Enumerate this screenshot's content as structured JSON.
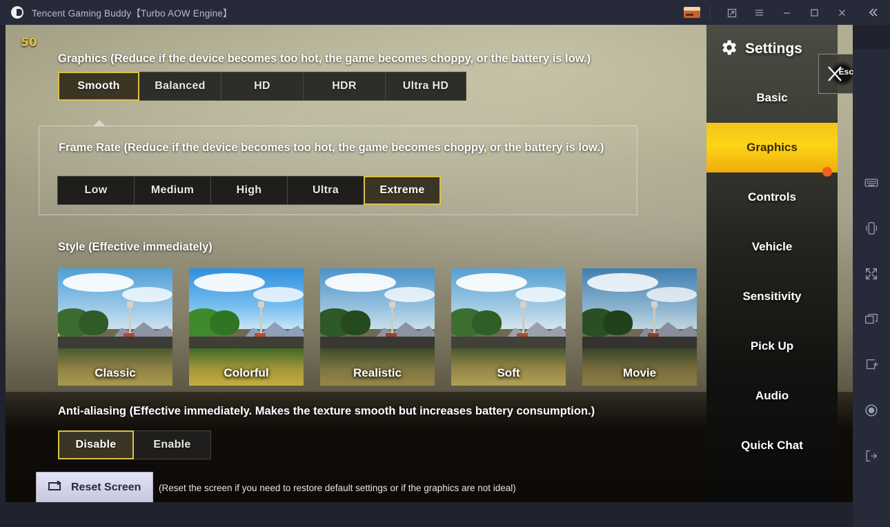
{
  "titlebar": {
    "title": "Tencent Gaming Buddy【Turbo AOW Engine】",
    "logo_icon": "tencent-logo-icon",
    "card_icon": "payment-card-icon",
    "popout_icon": "popout-icon",
    "menu_icon": "hamburger-menu-icon",
    "minimize_icon": "minimize-icon",
    "maximize_icon": "maximize-icon",
    "close_icon": "close-icon",
    "collapse_icon": "double-chevron-left-icon"
  },
  "game": {
    "fps": "50"
  },
  "graphics": {
    "heading": "Graphics (Reduce if the device becomes too hot, the game becomes choppy, or the battery is low.)",
    "options": [
      {
        "label": "Smooth",
        "selected": true
      },
      {
        "label": "Balanced",
        "selected": false
      },
      {
        "label": "HD",
        "selected": false
      },
      {
        "label": "HDR",
        "selected": false
      },
      {
        "label": "Ultra HD",
        "selected": false
      }
    ]
  },
  "frame_rate": {
    "heading": "Frame Rate (Reduce if the device becomes too hot, the game becomes choppy, or the battery is low.)",
    "options": [
      {
        "label": "Low",
        "selected": false
      },
      {
        "label": "Medium",
        "selected": false
      },
      {
        "label": "High",
        "selected": false
      },
      {
        "label": "Ultra",
        "selected": false
      },
      {
        "label": "Extreme",
        "selected": true
      }
    ]
  },
  "style": {
    "heading": "Style (Effective immediately)",
    "options": [
      {
        "label": "Classic",
        "selected": true
      },
      {
        "label": "Colorful",
        "selected": false
      },
      {
        "label": "Realistic",
        "selected": false
      },
      {
        "label": "Soft",
        "selected": false
      },
      {
        "label": "Movie",
        "selected": false
      }
    ]
  },
  "anti_aliasing": {
    "heading": "Anti-aliasing (Effective immediately. Makes the texture smooth but increases battery consumption.)",
    "options": [
      {
        "label": "Disable",
        "selected": true
      },
      {
        "label": "Enable",
        "selected": false
      }
    ]
  },
  "reset": {
    "button_label": "Reset Screen",
    "button_icon": "reset-screen-icon",
    "note": "(Reset the screen if you need to restore default settings or if the graphics are not ideal)"
  },
  "settings": {
    "title": "Settings",
    "gear_icon": "gear-icon",
    "close_label": "Esc",
    "close_icon": "esc-close-icon",
    "items": [
      {
        "label": "Basic",
        "active": false,
        "dot": false
      },
      {
        "label": "Graphics",
        "active": true,
        "dot": true
      },
      {
        "label": "Controls",
        "active": false,
        "dot": false
      },
      {
        "label": "Vehicle",
        "active": false,
        "dot": false
      },
      {
        "label": "Sensitivity",
        "active": false,
        "dot": false
      },
      {
        "label": "Pick Up",
        "active": false,
        "dot": false
      },
      {
        "label": "Audio",
        "active": false,
        "dot": false
      },
      {
        "label": "Quick Chat",
        "active": false,
        "dot": false
      }
    ]
  },
  "dock": {
    "items": [
      {
        "icon": "keyboard-icon"
      },
      {
        "icon": "shake-phone-icon"
      },
      {
        "icon": "fullscreen-icon"
      },
      {
        "icon": "multi-window-icon"
      },
      {
        "icon": "screenshot-icon"
      },
      {
        "icon": "record-icon"
      },
      {
        "icon": "exit-icon"
      }
    ]
  },
  "colors": {
    "accent_yellow": "#fbd417",
    "selection_border": "#d9c24a",
    "fps_text": "#e8c13c",
    "notify_dot": "#f2601a",
    "titlebar_bg": "#272b39"
  }
}
